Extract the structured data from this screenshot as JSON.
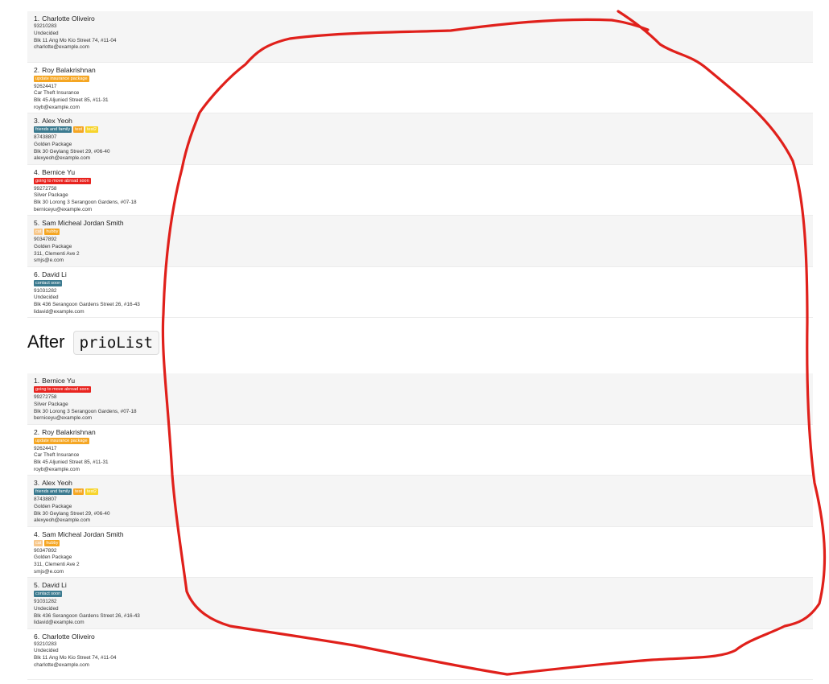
{
  "heading": {
    "prefix": "After",
    "command": "prioList"
  },
  "tag_colors": {
    "update insurance package": "#f5a623",
    "friends and family": "#3b7a8f",
    "test": "#f5a623",
    "test2": "#f7d42b",
    "going to move abroad soon": "#e8231e",
    "cat": "#f7c78a",
    "hubby": "#f5a623",
    "contact soon": "#3b7a8f"
  },
  "before_list": [
    {
      "index": "1.",
      "name": "Charlotte Oliveiro",
      "tags": [],
      "phone": "93210283",
      "package": "Undecided",
      "address": "Blk 11 Ang Mo Kio Street 74, #11-04",
      "email": "charlotte@example.com"
    },
    {
      "index": "2.",
      "name": "Roy Balakrishnan",
      "tags": [
        "update insurance package"
      ],
      "phone": "92624417",
      "package": "Car Theft Insurance",
      "address": "Blk 45 Aljunied Street 85, #11-31",
      "email": "royb@example.com"
    },
    {
      "index": "3.",
      "name": "Alex Yeoh",
      "tags": [
        "friends and family",
        "test",
        "test2"
      ],
      "phone": "87438807",
      "package": "Golden Package",
      "address": "Blk 30 Geylang Street 29, #06-40",
      "email": "alexyeoh@example.com"
    },
    {
      "index": "4.",
      "name": "Bernice Yu",
      "tags": [
        "going to move abroad soon"
      ],
      "phone": "99272758",
      "package": "Silver Package",
      "address": "Blk 30 Lorong 3 Serangoon Gardens, #07-18",
      "email": "berniceyu@example.com"
    },
    {
      "index": "5.",
      "name": "Sam Micheal Jordan Smith",
      "tags": [
        "cat",
        "hubby"
      ],
      "phone": "90347892",
      "package": "Golden Package",
      "address": "311, Clementi Ave 2",
      "email": "smjs@e.com"
    },
    {
      "index": "6.",
      "name": "David Li",
      "tags": [
        "contact soon"
      ],
      "phone": "91031282",
      "package": "Undecided",
      "address": "Blk 436 Serangoon Gardens Street 26, #16-43",
      "email": "lidavid@example.com"
    }
  ],
  "after_list": [
    {
      "index": "1.",
      "name": "Bernice Yu",
      "tags": [
        "going to move abroad soon"
      ],
      "phone": "99272758",
      "package": "Silver Package",
      "address": "Blk 30 Lorong 3 Serangoon Gardens, #07-18",
      "email": "berniceyu@example.com"
    },
    {
      "index": "2.",
      "name": "Roy Balakrishnan",
      "tags": [
        "update insurance package"
      ],
      "phone": "92624417",
      "package": "Car Theft Insurance",
      "address": "Blk 45 Aljunied Street 85, #11-31",
      "email": "royb@example.com"
    },
    {
      "index": "3.",
      "name": "Alex Yeoh",
      "tags": [
        "friends and family",
        "test",
        "test2"
      ],
      "phone": "87438807",
      "package": "Golden Package",
      "address": "Blk 30 Geylang Street 29, #06-40",
      "email": "alexyeoh@example.com"
    },
    {
      "index": "4.",
      "name": "Sam Micheal Jordan Smith",
      "tags": [
        "cat",
        "hubby"
      ],
      "phone": "90347892",
      "package": "Golden Package",
      "address": "311, Clementi Ave 2",
      "email": "smjs@e.com"
    },
    {
      "index": "5.",
      "name": "David Li",
      "tags": [
        "contact soon"
      ],
      "phone": "91031282",
      "package": "Undecided",
      "address": "Blk 436 Serangoon Gardens Street 26, #16-43",
      "email": "lidavid@example.com"
    },
    {
      "index": "6.",
      "name": "Charlotte Oliveiro",
      "tags": [],
      "phone": "93210283",
      "package": "Undecided",
      "address": "Blk 11 Ang Mo Kio Street 74, #11-04",
      "email": "charlotte@example.com"
    }
  ],
  "annotation": {
    "stroke_color": "#e0201b"
  }
}
